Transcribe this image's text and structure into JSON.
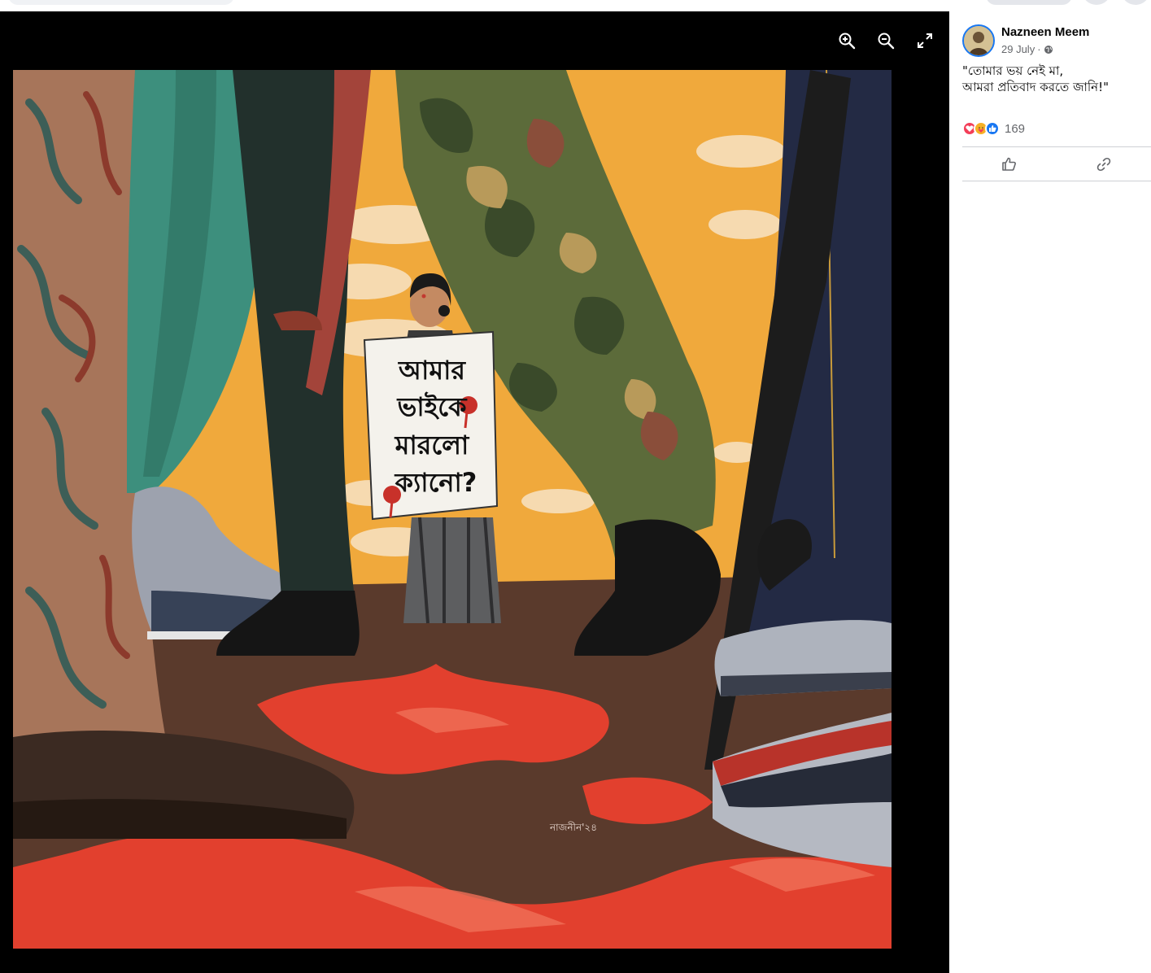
{
  "post": {
    "author": "Nazneen Meem",
    "date": "29 July",
    "separator": "·",
    "text_line1": "\"তোমার ভয় নেই মা,",
    "text_line2": "আমরা প্রতিবাদ করতে জানি!\"",
    "reaction_count": "169"
  },
  "artwork": {
    "sign_line1": "আমার",
    "sign_line2": "ভাইকে",
    "sign_line3": "মারলো",
    "sign_line4": "ক্যানো?",
    "signature": "নাজনীন'২৪"
  },
  "icons": {
    "zoom_in": "zoom-in-icon",
    "zoom_out": "zoom-out-icon",
    "fullscreen": "fullscreen-icon",
    "like": "like-icon",
    "link": "link-icon",
    "globe": "globe-icon"
  },
  "colors": {
    "accent": "#1877f2",
    "viewer_bg": "#000000",
    "sky": "#f0a93c",
    "blood": "#e2402e"
  }
}
